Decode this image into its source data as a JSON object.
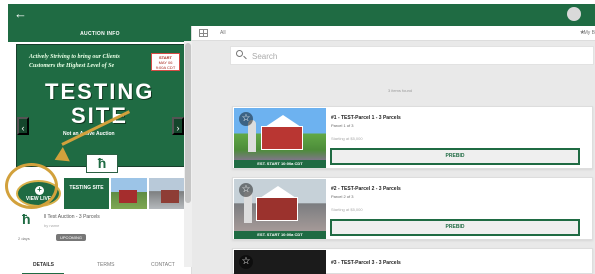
{
  "header": {
    "back_icon": "arrow-left-icon",
    "auction_info": "AUCTION INFO",
    "filter_all": "All",
    "my_label": "My B"
  },
  "hero": {
    "script_line_1": "Actively Striving to bring our Clients",
    "script_line_2": "Customers the Highest Level of Se",
    "date_top": "START",
    "date_month_day": "MAY 06",
    "date_time": "9:00A CDT",
    "testing": "TESTING",
    "site": "SITE",
    "status_text": "Not an Active Auction"
  },
  "left_panel": {
    "view_live": "VIEW LIVE",
    "thumb_text": "TESTING SITE",
    "auction_title": "ll Test Auction - 3 Parcels",
    "by_line": "by name",
    "timer": "2 days",
    "badge": "UPCOMING",
    "tabs": [
      "DETAILS",
      "TERMS",
      "CONTACT"
    ]
  },
  "search": {
    "placeholder": "Search",
    "results": "3 items found"
  },
  "lots": [
    {
      "title": "#1 - TEST-Parcel 1 - 3 Parcels",
      "parcel": "Parcel 1 of 3",
      "starting": "Starting at $5,000",
      "start_band": "EST. START 10:00a CDT",
      "button": "PREBID"
    },
    {
      "title": "#2 - TEST-Parcel 2 - 3 Parcels",
      "parcel": "Parcel 2 of 3",
      "starting": "Starting at $5,000",
      "start_band": "EST. START 10:00a CDT",
      "button": "PREBID"
    },
    {
      "title": "#3 - TEST-Parcel 3 - 3 Parcels",
      "parcel": "",
      "starting": "",
      "start_band": "",
      "button": ""
    }
  ],
  "colors": {
    "brand_green": "#1f6b43",
    "accent_gold": "#d2a13c",
    "background_gray": "#e9e9e9"
  }
}
